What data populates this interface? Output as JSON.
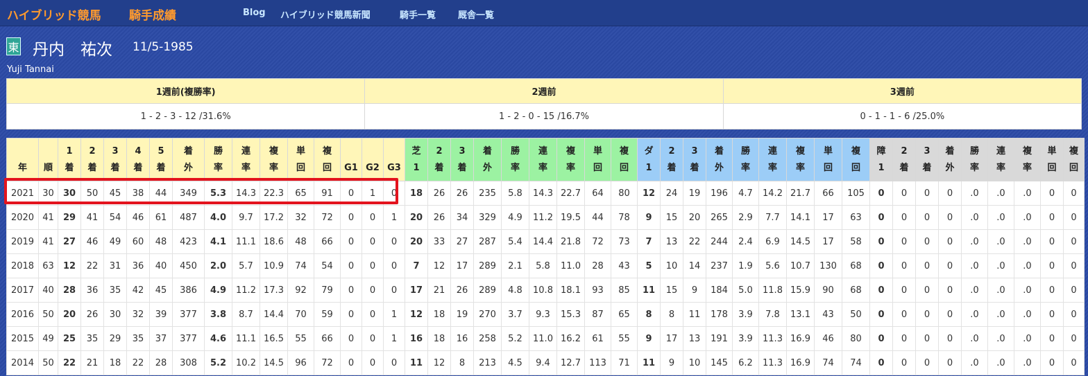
{
  "site": {
    "title": "ハイブリッド競馬",
    "subtitle": "騎手成績",
    "nav": [
      "Blog",
      "ハイブリッド競馬新聞",
      "騎手一覧",
      "厩舎一覧"
    ]
  },
  "jockey": {
    "affiliation": "東",
    "name": "丹内　祐次",
    "birth": "11/5-1985",
    "name_roman": "Yuji Tannai"
  },
  "recent": {
    "headers": [
      "1週前(複勝率)",
      "2週前",
      "3週前"
    ],
    "values": [
      "1 - 2 - 3 - 12 /31.6%",
      "1 - 2 - 0 - 15 /16.7%",
      "0 - 1 - 1 - 6 /25.0%"
    ]
  },
  "table": {
    "headers": [
      [
        "年"
      ],
      [
        "順"
      ],
      [
        "1",
        "着"
      ],
      [
        "2",
        "着"
      ],
      [
        "3",
        "着"
      ],
      [
        "4",
        "着"
      ],
      [
        "5",
        "着"
      ],
      [
        "着",
        "外"
      ],
      [
        "勝",
        "率"
      ],
      [
        "連",
        "率"
      ],
      [
        "複",
        "率"
      ],
      [
        "単",
        "回"
      ],
      [
        "複",
        "回"
      ],
      [
        "G1"
      ],
      [
        "G2"
      ],
      [
        "G3"
      ],
      [
        "芝",
        "1"
      ],
      [
        "2",
        "着"
      ],
      [
        "3",
        "着"
      ],
      [
        "着",
        "外"
      ],
      [
        "勝",
        "率"
      ],
      [
        "連",
        "率"
      ],
      [
        "複",
        "率"
      ],
      [
        "単",
        "回"
      ],
      [
        "複",
        "回"
      ],
      [
        "ダ",
        "1"
      ],
      [
        "2",
        "着"
      ],
      [
        "3",
        "着"
      ],
      [
        "着",
        "外"
      ],
      [
        "勝",
        "率"
      ],
      [
        "連",
        "率"
      ],
      [
        "複",
        "率"
      ],
      [
        "単",
        "回"
      ],
      [
        "複",
        "回"
      ],
      [
        "障",
        "1"
      ],
      [
        "2",
        "着"
      ],
      [
        "3",
        "着"
      ],
      [
        "着",
        "外"
      ],
      [
        "勝",
        "率"
      ],
      [
        "連",
        "率"
      ],
      [
        "複",
        "率"
      ],
      [
        "単",
        "回"
      ],
      [
        "複",
        "回"
      ]
    ],
    "rows": [
      [
        "2021",
        "30",
        "30",
        "50",
        "45",
        "38",
        "44",
        "349",
        "5.3",
        "14.3",
        "22.3",
        "65",
        "91",
        "0",
        "1",
        "0",
        "18",
        "26",
        "26",
        "235",
        "5.8",
        "14.3",
        "22.7",
        "64",
        "80",
        "12",
        "24",
        "19",
        "196",
        "4.7",
        "14.2",
        "21.7",
        "66",
        "105",
        "0",
        "0",
        "0",
        "0",
        ".0",
        ".0",
        ".0",
        "0",
        "0"
      ],
      [
        "2020",
        "41",
        "29",
        "41",
        "54",
        "46",
        "61",
        "487",
        "4.0",
        "9.7",
        "17.2",
        "32",
        "72",
        "0",
        "0",
        "1",
        "20",
        "26",
        "34",
        "329",
        "4.9",
        "11.2",
        "19.5",
        "44",
        "78",
        "9",
        "15",
        "20",
        "265",
        "2.9",
        "7.7",
        "14.1",
        "17",
        "63",
        "0",
        "0",
        "0",
        "0",
        ".0",
        ".0",
        ".0",
        "0",
        "0"
      ],
      [
        "2019",
        "41",
        "27",
        "46",
        "49",
        "60",
        "48",
        "423",
        "4.1",
        "11.1",
        "18.6",
        "48",
        "66",
        "0",
        "0",
        "0",
        "20",
        "33",
        "27",
        "287",
        "5.4",
        "14.4",
        "21.8",
        "72",
        "73",
        "7",
        "13",
        "22",
        "244",
        "2.4",
        "6.9",
        "14.5",
        "17",
        "58",
        "0",
        "0",
        "0",
        "0",
        ".0",
        ".0",
        ".0",
        "0",
        "0"
      ],
      [
        "2018",
        "63",
        "12",
        "22",
        "31",
        "36",
        "40",
        "450",
        "2.0",
        "5.7",
        "10.9",
        "74",
        "54",
        "0",
        "0",
        "0",
        "7",
        "12",
        "17",
        "289",
        "2.1",
        "5.8",
        "11.0",
        "28",
        "43",
        "5",
        "10",
        "14",
        "237",
        "1.9",
        "5.6",
        "10.7",
        "130",
        "68",
        "0",
        "0",
        "0",
        "0",
        ".0",
        ".0",
        ".0",
        "0",
        "0"
      ],
      [
        "2017",
        "40",
        "28",
        "36",
        "35",
        "42",
        "45",
        "386",
        "4.9",
        "11.2",
        "17.3",
        "92",
        "79",
        "0",
        "0",
        "0",
        "17",
        "21",
        "26",
        "289",
        "4.8",
        "10.8",
        "18.1",
        "93",
        "85",
        "11",
        "15",
        "9",
        "184",
        "5.0",
        "11.8",
        "15.9",
        "90",
        "68",
        "0",
        "0",
        "0",
        "0",
        ".0",
        ".0",
        ".0",
        "0",
        "0"
      ],
      [
        "2016",
        "50",
        "20",
        "26",
        "30",
        "32",
        "39",
        "377",
        "3.8",
        "8.7",
        "14.4",
        "70",
        "59",
        "0",
        "0",
        "1",
        "12",
        "18",
        "19",
        "270",
        "3.7",
        "9.3",
        "15.3",
        "87",
        "65",
        "8",
        "8",
        "11",
        "178",
        "3.9",
        "7.8",
        "13.1",
        "43",
        "50",
        "0",
        "0",
        "0",
        "0",
        ".0",
        ".0",
        ".0",
        "0",
        "0"
      ],
      [
        "2015",
        "49",
        "25",
        "35",
        "29",
        "35",
        "37",
        "377",
        "4.6",
        "11.1",
        "16.5",
        "55",
        "66",
        "0",
        "0",
        "1",
        "16",
        "18",
        "16",
        "258",
        "5.2",
        "11.0",
        "16.2",
        "61",
        "55",
        "9",
        "17",
        "13",
        "191",
        "3.9",
        "11.3",
        "16.9",
        "46",
        "80",
        "0",
        "0",
        "0",
        "0",
        ".0",
        ".0",
        ".0",
        "0",
        "0"
      ],
      [
        "2014",
        "50",
        "22",
        "21",
        "18",
        "22",
        "28",
        "308",
        "5.2",
        "10.2",
        "14.5",
        "96",
        "72",
        "0",
        "0",
        "0",
        "11",
        "12",
        "8",
        "213",
        "4.5",
        "9.4",
        "12.7",
        "113",
        "71",
        "11",
        "9",
        "10",
        "145",
        "6.2",
        "11.3",
        "16.9",
        "74",
        "74",
        "0",
        "0",
        "0",
        "0",
        ".0",
        ".0",
        ".0",
        "0",
        "0"
      ]
    ]
  },
  "colors": {
    "accent": "#ff9a2e",
    "nav": "#c8e6ff",
    "highlight": "#e3141e",
    "header_yellow": "#fff6b8",
    "turf_green": "#9cf2a2",
    "dirt_blue": "#9ccdf7",
    "jump_gray": "#d9d9d9",
    "background": "#2b4aa6"
  },
  "highlighted_row": "2021"
}
